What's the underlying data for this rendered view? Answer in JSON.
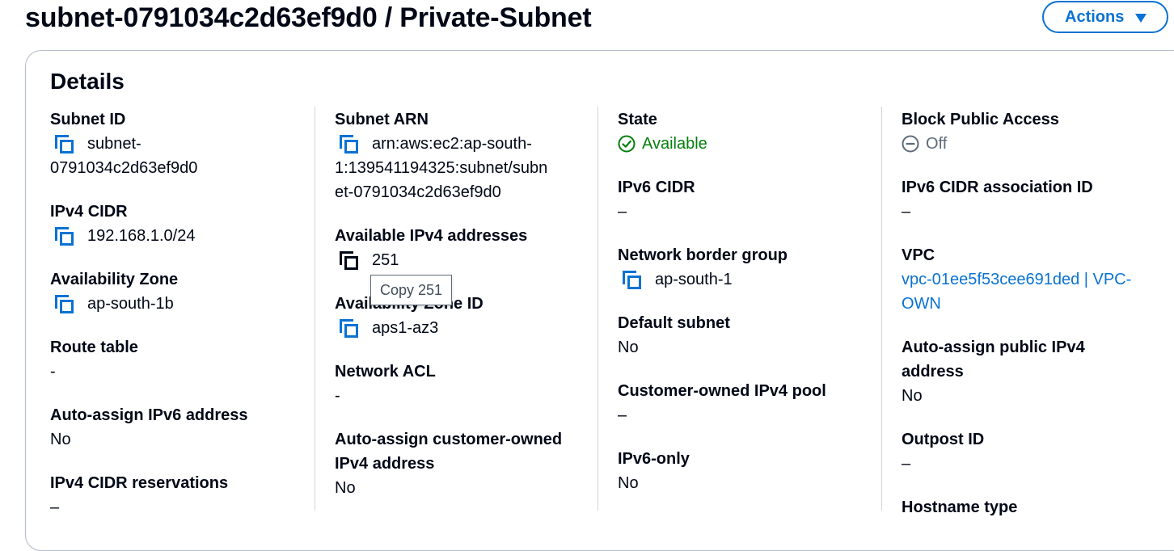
{
  "header": {
    "title": "subnet-0791034c2d63ef9d0 / Private-Subnet",
    "actions_label": "Actions"
  },
  "details": {
    "title": "Details",
    "col1": {
      "subnet_id_label": "Subnet ID",
      "subnet_id_line1": "subnet-",
      "subnet_id_line2": "0791034c2d63ef9d0",
      "ipv4_cidr_label": "IPv4 CIDR",
      "ipv4_cidr_value": "192.168.1.0/24",
      "az_label": "Availability Zone",
      "az_value": "ap-south-1b",
      "route_table_label": "Route table",
      "route_table_value": "-",
      "auto_ipv6_label": "Auto-assign IPv6 address",
      "auto_ipv6_value": "No",
      "cidr_res_label": "IPv4 CIDR reservations",
      "cidr_res_value": "–"
    },
    "col2": {
      "arn_label": "Subnet ARN",
      "arn_line1": "arn:aws:ec2:ap-south-",
      "arn_line2": "1:139541194325:subnet/subn",
      "arn_line3": "et-0791034c2d63ef9d0",
      "avail_ipv4_label": "Available IPv4 addresses",
      "avail_ipv4_value": "251",
      "az_id_label": "Availability Zone ID",
      "az_id_value": "aps1-az3",
      "nacl_label": "Network ACL",
      "nacl_value": "-",
      "auto_coip_label_line1": "Auto-assign customer-owned",
      "auto_coip_label_line2": "IPv4 address",
      "auto_coip_value": "No"
    },
    "col3": {
      "state_label": "State",
      "state_value": "Available",
      "ipv6_cidr_label": "IPv6 CIDR",
      "ipv6_cidr_value": "–",
      "nbg_label": "Network border group",
      "nbg_value": "ap-south-1",
      "default_subnet_label": "Default subnet",
      "default_subnet_value": "No",
      "coip_pool_label": "Customer-owned IPv4 pool",
      "coip_pool_value": "–",
      "ipv6_only_label": "IPv6-only",
      "ipv6_only_value": "No"
    },
    "col4": {
      "bpa_label": "Block Public Access",
      "bpa_value": "Off",
      "ipv6_assoc_label": "IPv6 CIDR association ID",
      "ipv6_assoc_value": "–",
      "vpc_label": "VPC",
      "vpc_line1": "vpc-01ee5f53cee691ded | VPC-",
      "vpc_line2": "OWN",
      "auto_public_label_line1": "Auto-assign public IPv4",
      "auto_public_label_line2": "address",
      "auto_public_value": "No",
      "outpost_label": "Outpost ID",
      "outpost_value": "–",
      "hostname_label": "Hostname type"
    }
  },
  "tooltip": {
    "text": "Copy 251"
  },
  "colors": {
    "accent": "#0972d3",
    "success": "#037f0c",
    "muted": "#5f6b7a",
    "text": "#000716"
  }
}
